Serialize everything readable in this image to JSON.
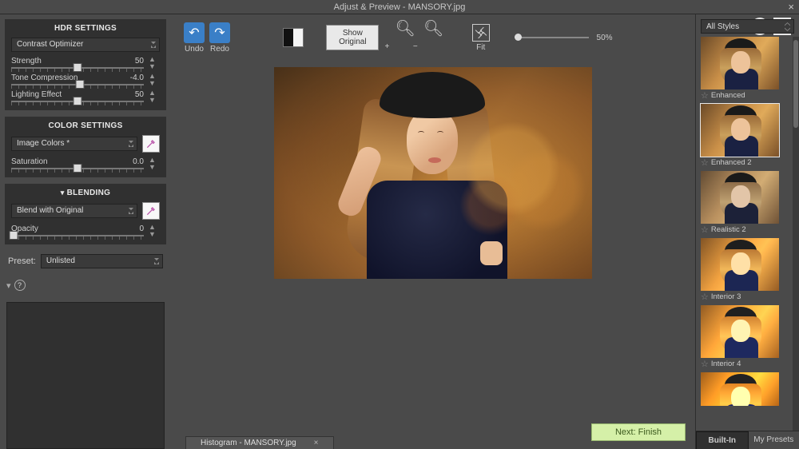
{
  "titlebar": {
    "text": "Adjust & Preview - MANSORY.jpg"
  },
  "hdr": {
    "title": "HDR SETTINGS",
    "mode": "Contrast Optimizer",
    "strength": {
      "label": "Strength",
      "value": "50",
      "pos": 50
    },
    "tone": {
      "label": "Tone Compression",
      "value": "-4.0",
      "pos": 52
    },
    "light": {
      "label": "Lighting Effect",
      "value": "50",
      "pos": 50
    }
  },
  "color": {
    "title": "COLOR SETTINGS",
    "mode": "Image Colors *",
    "saturation": {
      "label": "Saturation",
      "value": "0.0",
      "pos": 50
    }
  },
  "blending": {
    "title": "BLENDING",
    "mode": "Blend with Original",
    "opacity": {
      "label": "Opacity",
      "value": "0",
      "pos": 2
    }
  },
  "preset": {
    "label": "Preset:",
    "value": "Unlisted"
  },
  "toolbar": {
    "undo": "Undo",
    "redo": "Redo",
    "show_original": "Show Original",
    "fit": "Fit",
    "zoom": "50%"
  },
  "next_button": "Next: Finish",
  "histogram": {
    "label": "Histogram - MANSORY.jpg"
  },
  "styles": {
    "dropdown": "All Styles",
    "items": [
      {
        "label": "Enhanced"
      },
      {
        "label": "Enhanced 2"
      },
      {
        "label": "Realistic 2"
      },
      {
        "label": "Interior 3"
      },
      {
        "label": "Interior 4"
      },
      {
        "label": ""
      }
    ],
    "tab_builtin": "Built-In",
    "tab_my": "My Presets"
  }
}
